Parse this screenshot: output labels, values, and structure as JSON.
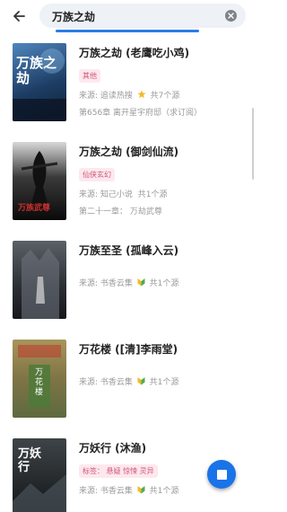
{
  "search": {
    "query": "万族之劫"
  },
  "results": [
    {
      "title": "万族之劫 (老鹰吃小鸡)",
      "tag": "其他",
      "source": "来源: 追读热搜",
      "source_count": "共7个源",
      "source_icon": "star-icon",
      "latest": "第656章 离开星宇府邸（求订阅）",
      "cover_text": "万族之劫",
      "cover_bg": "#2f5b8f"
    },
    {
      "title": "万族之劫 (御剑仙流)",
      "tag": "仙侠玄幻",
      "source": "来源: 知己小说",
      "source_count": "共1个源",
      "latest": "第二十一章： 万劫武尊",
      "cover_text": "万族武尊",
      "cover_bg": "#101216"
    },
    {
      "title": "万族至圣 (孤峰入云)",
      "source": "来源: 书香云集",
      "source_count": "共1个源",
      "source_icon": "leaf-badge-icon",
      "cover_bg": "#3a3f47"
    },
    {
      "title": "万花楼 ([清]李雨堂)",
      "source": "来源: 书香云集",
      "source_count": "共1个源",
      "source_icon": "leaf-badge-icon",
      "cover_text": "万花楼",
      "cover_bg": "#8b7e4a"
    },
    {
      "title": "万妖行 (沐渔)",
      "tag": "标签： 悬疑 惊悚 灵异",
      "source": "来源: 书香云集",
      "source_count": "共1个源",
      "source_icon": "leaf-badge-icon",
      "cover_text": "万妖行",
      "cover_bg": "#2d3236"
    }
  ]
}
